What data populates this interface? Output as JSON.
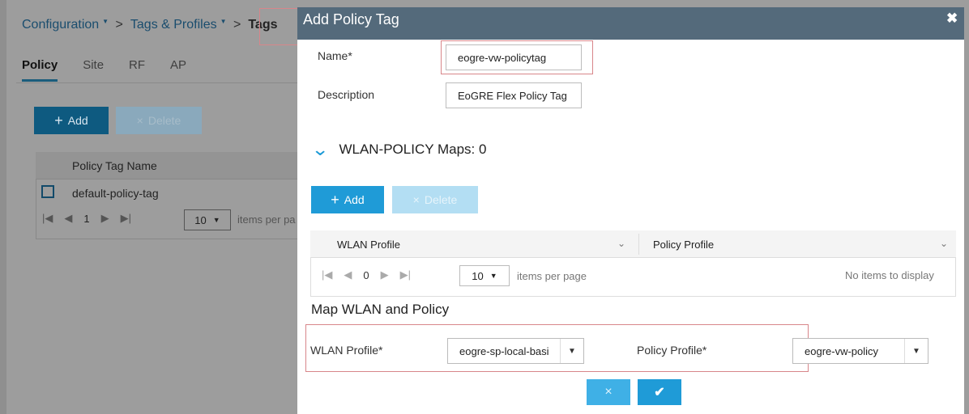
{
  "background": {
    "breadcrumb": [
      "Configuration",
      "Tags & Profiles",
      "Tags"
    ],
    "tabs": [
      "Policy",
      "Site",
      "RF",
      "AP"
    ],
    "add_label": "Add",
    "delete_label": "Delete",
    "column_header": "Policy Tag Name",
    "rows": [
      "default-policy-tag"
    ],
    "pager": {
      "page": "1",
      "page_size": "10",
      "items_per_page": "items per pa"
    }
  },
  "dialog": {
    "title": "Add Policy Tag",
    "close_glyph": "✖",
    "name_label": "Name*",
    "name_value": "eogre-vw-policytag",
    "description_label": "Description",
    "description_value": "EoGRE Flex Policy Tag",
    "maps_header": "WLAN-POLICY Maps: 0",
    "add_label": "Add",
    "delete_label": "Delete",
    "grid": {
      "columns": [
        "WLAN Profile",
        "Policy Profile"
      ],
      "page": "0",
      "page_size": "10",
      "items_per_page": "items per page",
      "empty_text": "No items to display"
    },
    "map_section_title": "Map WLAN and Policy",
    "wlan_profile_label": "WLAN Profile*",
    "wlan_profile_value": "eogre-sp-local-basi",
    "policy_profile_label": "Policy Profile*",
    "policy_profile_value": "eogre-vw-policy"
  },
  "colors": {
    "dialog_header": "#546a7b",
    "primary_button": "#1f9bd7",
    "highlight_box": "#d8868a"
  }
}
